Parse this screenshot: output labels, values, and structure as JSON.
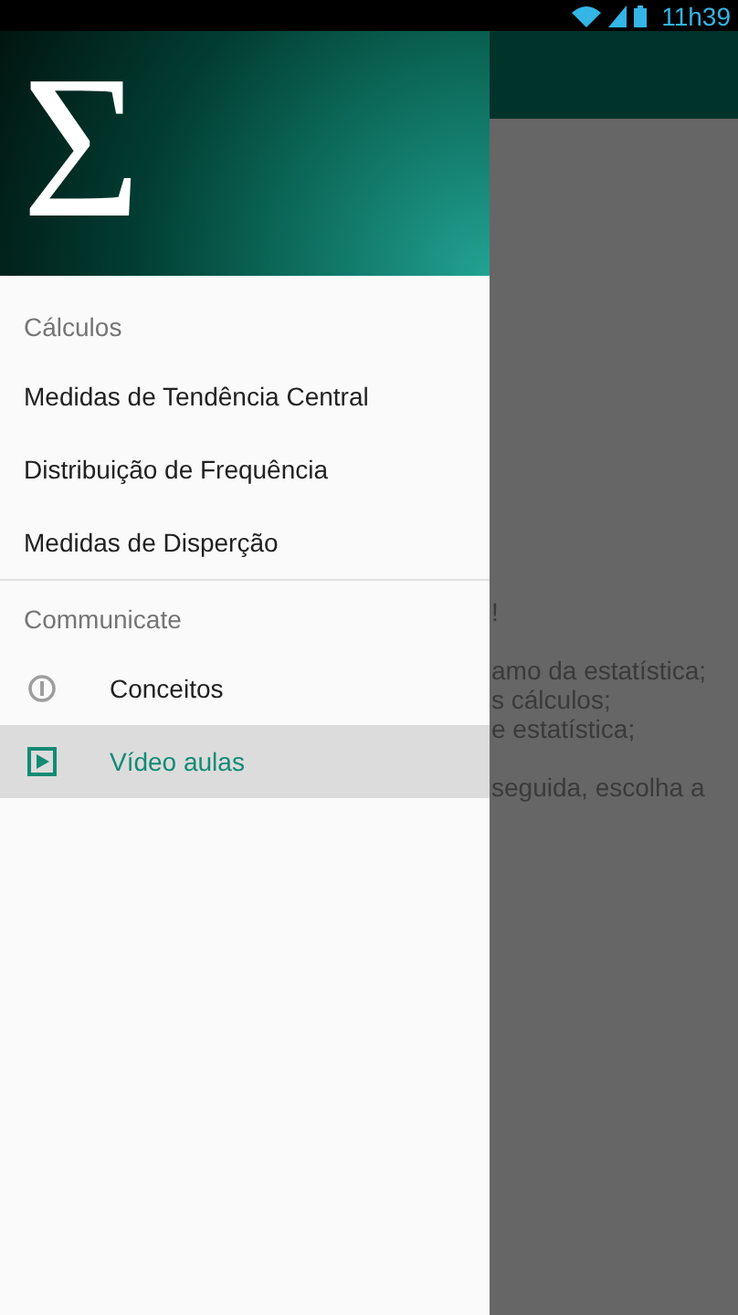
{
  "status_bar": {
    "time": "11h39"
  },
  "drawer": {
    "logo": "Σ",
    "sections": [
      {
        "title": "Cálculos",
        "items": [
          {
            "label": "Medidas de Tendência Central",
            "selected": false,
            "kind": "plain"
          },
          {
            "label": "Distribuição de Frequência",
            "selected": false,
            "kind": "plain"
          },
          {
            "label": "Medidas de Disperção",
            "selected": false,
            "kind": "plain"
          }
        ]
      },
      {
        "title": "Communicate",
        "items": [
          {
            "label": "Conceitos",
            "selected": false,
            "kind": "icon"
          },
          {
            "label": "Vídeo aulas",
            "selected": true,
            "kind": "icon"
          }
        ]
      }
    ]
  },
  "content": {
    "paragraphs": [
      [
        "!"
      ],
      [
        "amo da estatística;",
        "s cálculos;",
        "e estatística;"
      ],
      [
        "seguida, escolha a"
      ]
    ]
  }
}
